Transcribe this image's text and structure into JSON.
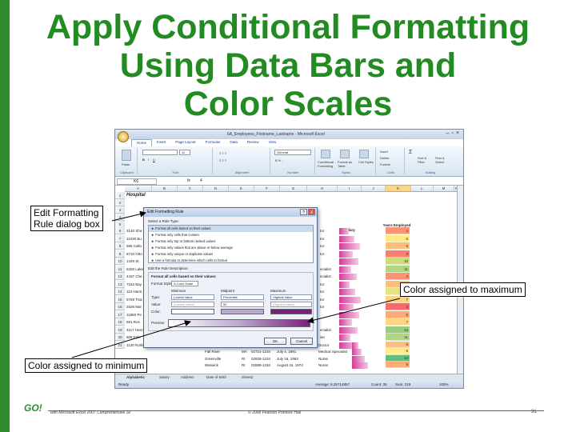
{
  "slide": {
    "title_lines": [
      "Apply Conditional Formatting",
      "Using Data Bars and",
      "Color Scales"
    ],
    "footer_left": "with Microsoft Excel 2007 Comprehensive 1e",
    "footer_mid": "© 2008 Pearson Prentice Hall",
    "footer_right": "31",
    "logo_text": "GO!"
  },
  "callouts": {
    "edit_rule": "Edit Formatting\nRule dialog box",
    "maximum": "Color assigned to maximum",
    "minimum": "Color assigned to minimum"
  },
  "excel": {
    "window_title": "6A_Employees_Firstname_Lastname - Microsoft Excel",
    "tabs": [
      "Home",
      "Insert",
      "Page Layout",
      "Formulas",
      "Data",
      "Review",
      "View"
    ],
    "ribbon_groups": [
      "Clipboard",
      "Font",
      "Alignment",
      "Number",
      "Styles",
      "Cells",
      "Editing"
    ],
    "ribbon_buttons": {
      "paste": "Paste",
      "font_size": "11",
      "number_format": "General",
      "conditional": "Conditional Formatting",
      "format_table": "Format as Table",
      "cell_styles": "Cell Styles",
      "insert": "Insert",
      "delete": "Delete",
      "format": "Format",
      "sort": "Sort & Filter",
      "find": "Find & Select"
    },
    "name_box": "K6",
    "formula_fx": "fx",
    "formula_value": "4",
    "columns": [
      "A",
      "B",
      "C",
      "D",
      "E",
      "F",
      "G",
      "H",
      "I",
      "J",
      "K",
      "L",
      "M",
      "N"
    ],
    "hospital_label": "Hospital",
    "header_salary": "Salary",
    "header_years": "Years Employed",
    "rows": [
      "1",
      "2",
      "3",
      "4",
      "5",
      "6",
      "7",
      "8",
      "9",
      "10",
      "11",
      "12",
      "13",
      "14",
      "15",
      "16",
      "17",
      "18",
      "19",
      "20",
      "21"
    ],
    "col_a_values": [
      "3140 Sha",
      "11030 Bu",
      "566 Callo",
      "8710 Otto",
      "1449 St.",
      "6320 Lake",
      "4437 Che",
      "7163 Bay",
      "113 Harm",
      "5769 Trac",
      "2526 Mal",
      "11850 Pe",
      "681 Ros",
      "4117 Harm",
      "608 Eple",
      "1130 Rolling Springs Ln."
    ],
    "col_h_values": [
      "tor",
      "tor",
      "tor",
      "tor",
      "",
      "ecialist",
      "ecialist",
      "tor",
      "tor",
      "tor",
      "tor",
      "",
      "",
      "ecialist",
      "ian",
      "Doctor"
    ],
    "years_values": [
      "4",
      "8",
      "6",
      "3",
      "10",
      "11",
      "4",
      "6",
      "9",
      "7",
      "2",
      "5",
      "7",
      "12",
      "11",
      "",
      "7",
      "6"
    ],
    "bottom_rows": [
      {
        "city": "Providence",
        "state": "RI",
        "zip": "02902-1234",
        "date": "September 22, 1985",
        "title": "Doctor"
      },
      {
        "city": "Fall River",
        "state": "MA",
        "zip": "02721-1234",
        "date": "July 4, 1981",
        "title": "Medical Specialist"
      },
      {
        "city": "Greenville",
        "state": "RI",
        "zip": "02828-1234",
        "date": "July 16, 1953",
        "title": "Nurse"
      },
      {
        "city": "Warwick",
        "state": "RI",
        "zip": "02888-1234",
        "date": "August 16, 1974",
        "title": "Nurse"
      }
    ],
    "bottom_years": [
      "6",
      "8",
      "14",
      "5"
    ],
    "sheet_tabs": [
      "Alphabetic",
      "Salary",
      "Address",
      "Date of Birth",
      "Sheet2"
    ],
    "status_ready": "Ready",
    "status_avg": "Average: 6.25714857",
    "status_count": "Count: 35",
    "status_sum": "Sum: 219",
    "status_zoom": "100%"
  },
  "dialog": {
    "title": "Edit Formatting Rule",
    "help": "?",
    "close": "X",
    "select_rule_type": "Select a Rule Type:",
    "rule_types": [
      "► Format all cells based on their values",
      "► Format only cells that contain",
      "► Format only top or bottom ranked values",
      "► Format only values that are above or below average",
      "► Format only unique or duplicate values",
      "► Use a formula to determine which cells to format"
    ],
    "edit_description": "Edit the Rule Description:",
    "format_all_label": "Format all cells based on their values:",
    "format_style_label": "Format Style:",
    "format_style_value": "3-Color Scale",
    "minimum_label": "Minimum",
    "midpoint_label": "Midpoint",
    "maximum_label": "Maximum",
    "type_label": "Type:",
    "value_label": "Value:",
    "color_label": "Color:",
    "min_type": "Lowest Value",
    "mid_type": "Percentile",
    "max_type": "Highest Value",
    "min_value": "(Lowest value)",
    "mid_value": "50",
    "max_value": "(Highest value)",
    "preview_label": "Preview:",
    "ok": "OK",
    "cancel": "Cancel",
    "colors": {
      "minimum": "#ffffff",
      "midpoint": "#bca7cf",
      "maximum": "#7a1f7a"
    }
  }
}
